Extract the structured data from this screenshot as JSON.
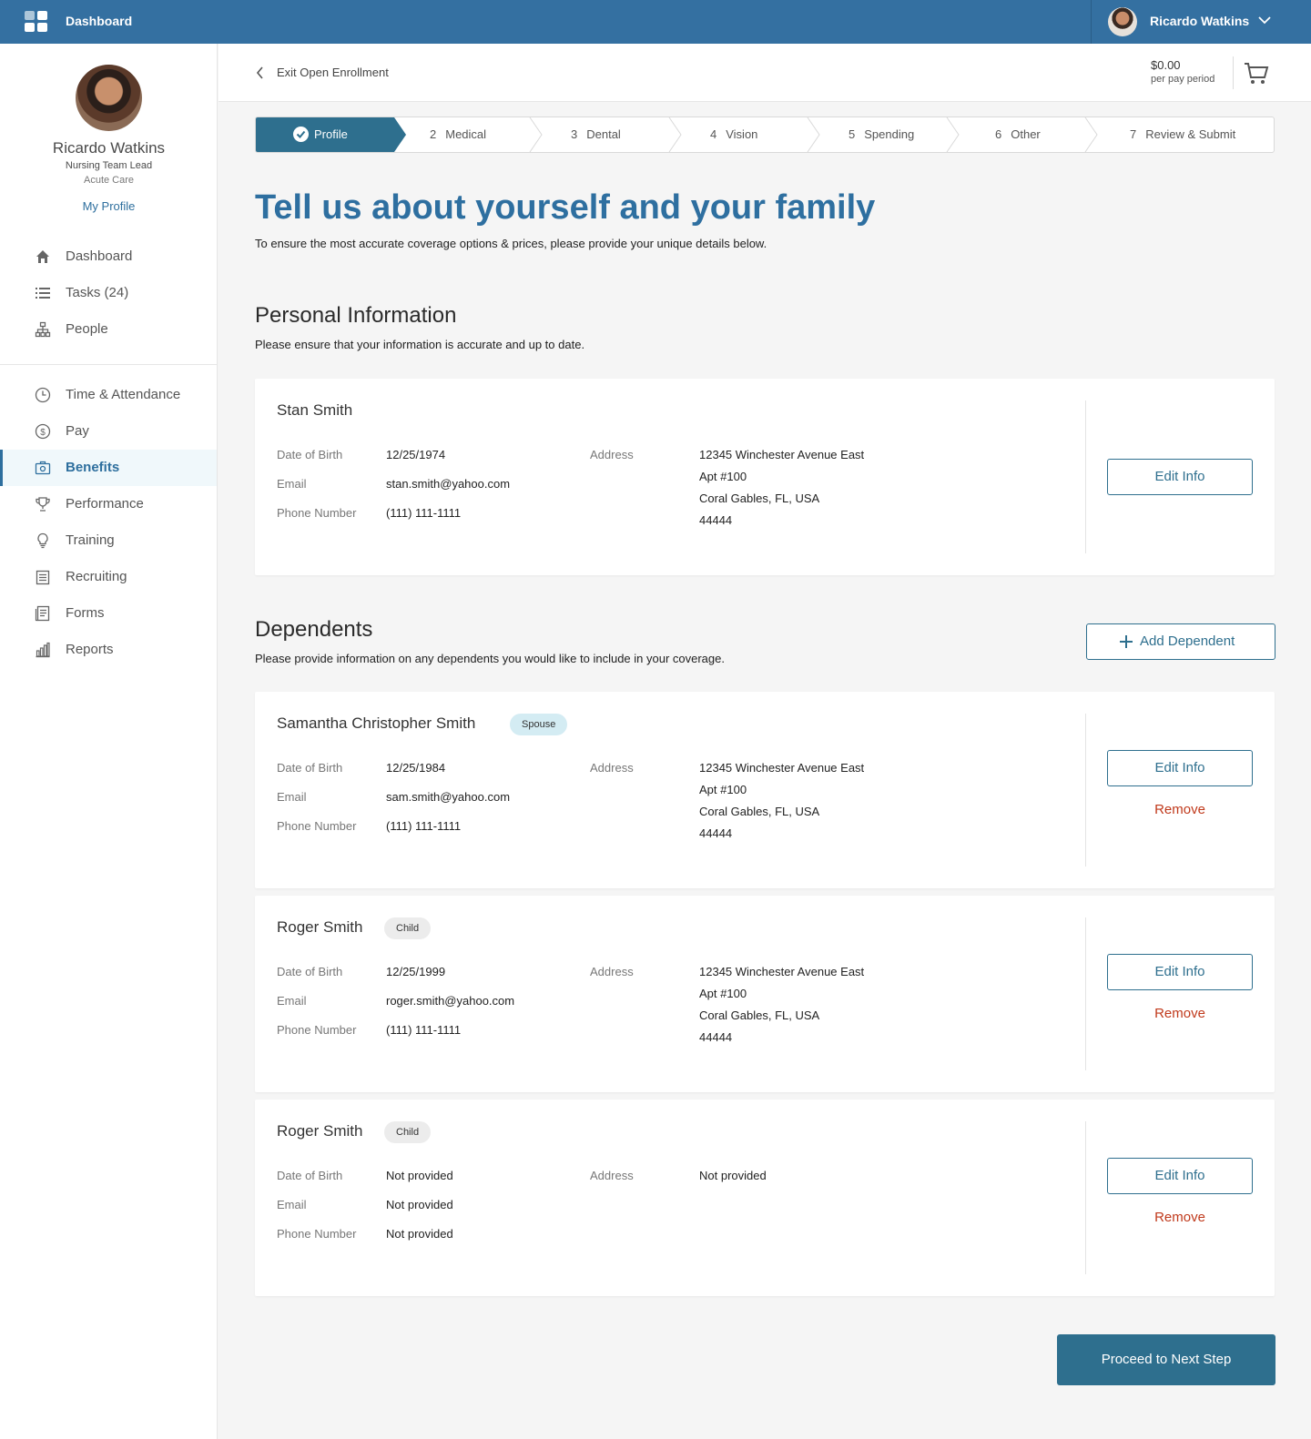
{
  "topbar": {
    "app_label": "Dashboard",
    "user_name": "Ricardo Watkins"
  },
  "sidebar": {
    "profile": {
      "name": "Ricardo Watkins",
      "title": "Nursing Team Lead",
      "department": "Acute Care",
      "link": "My Profile"
    },
    "items": [
      {
        "label": "Dashboard",
        "icon": "home-icon"
      },
      {
        "label": "Tasks (24)",
        "icon": "list-icon"
      },
      {
        "label": "People",
        "icon": "org-chart-icon"
      },
      {
        "label": "Time & Attendance",
        "icon": "clock-icon"
      },
      {
        "label": "Pay",
        "icon": "dollar-icon"
      },
      {
        "label": "Benefits",
        "icon": "benefits-icon",
        "active": true
      },
      {
        "label": "Performance",
        "icon": "trophy-icon"
      },
      {
        "label": "Training",
        "icon": "lightbulb-icon"
      },
      {
        "label": "Recruiting",
        "icon": "clipboard-icon"
      },
      {
        "label": "Forms",
        "icon": "forms-icon"
      },
      {
        "label": "Reports",
        "icon": "bar-chart-icon"
      }
    ]
  },
  "header": {
    "back_label": "Exit Open Enrollment",
    "cart_amount": "$0.00",
    "cart_period": "per pay period"
  },
  "stepper": {
    "steps": [
      {
        "num": "",
        "label": "Profile",
        "state": "complete"
      },
      {
        "num": "2",
        "label": "Medical"
      },
      {
        "num": "3",
        "label": "Dental"
      },
      {
        "num": "4",
        "label": "Vision"
      },
      {
        "num": "5",
        "label": "Spending"
      },
      {
        "num": "6",
        "label": "Other"
      },
      {
        "num": "7",
        "label": "Review & Submit"
      }
    ]
  },
  "main": {
    "title": "Tell us about yourself and your family",
    "subtitle": "To ensure the most accurate coverage options & prices, please provide your unique details below.",
    "personal": {
      "title": "Personal Information",
      "subtitle": "Please ensure that your information is accurate and up to date."
    },
    "dependents": {
      "title": "Dependents",
      "subtitle": "Please provide information on any dependents you would like to include in your coverage.",
      "add_label": "Add Dependent"
    },
    "labels": {
      "dob": "Date of Birth",
      "email": "Email",
      "phone": "Phone Number",
      "address": "Address",
      "edit": "Edit Info",
      "remove": "Remove"
    },
    "people": [
      {
        "name": "Stan Smith",
        "badge": "",
        "dob": "12/25/1974",
        "email": "stan.smith@yahoo.com",
        "phone": "(111) 111-1111",
        "address": [
          "12345 Winchester Avenue East",
          "Apt #100",
          "Coral Gables, FL, USA",
          "44444"
        ]
      },
      {
        "name": "Samantha Christopher Smith",
        "badge": "Spouse",
        "dob": "12/25/1984",
        "email": "sam.smith@yahoo.com",
        "phone": "(111) 111-1111",
        "address": [
          "12345 Winchester Avenue East",
          "Apt #100",
          "Coral Gables, FL, USA",
          "44444"
        ]
      },
      {
        "name": "Roger Smith",
        "badge": "Child",
        "dob": "12/25/1999",
        "email": "roger.smith@yahoo.com",
        "phone": "(111) 111-1111",
        "address": [
          "12345 Winchester Avenue East",
          "Apt #100",
          "Coral Gables, FL, USA",
          "44444"
        ]
      },
      {
        "name": "Roger Smith",
        "badge": "Child",
        "dob": "Not provided",
        "email": "Not provided",
        "phone": "Not provided",
        "address": [
          "Not provided"
        ]
      }
    ],
    "proceed_label": "Proceed to Next Step"
  },
  "colors": {
    "brand": "#3470a1",
    "accent": "#2e6f8e",
    "danger": "#c0391b",
    "spouse_badge": "#d4ecf3"
  }
}
